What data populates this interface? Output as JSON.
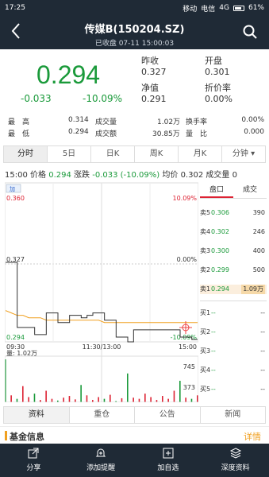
{
  "status": {
    "time": "17:25",
    "carrier1": "移动",
    "carrier2": "电信",
    "network": "4G",
    "battery": "61%"
  },
  "header": {
    "title": "传媒B(150204.SZ)",
    "subtitle": "已收盘 07-11 15:00:03"
  },
  "quote": {
    "price": "0.294",
    "change": "-0.033",
    "change_pct": "-10.09%",
    "prev_close_label": "昨收",
    "prev_close": "0.327",
    "open_label": "开盘",
    "open": "0.301",
    "nav_label": "净值",
    "nav": "0.291",
    "discount_label": "折价率",
    "discount": "0.00%"
  },
  "stats": {
    "high_label": "最　高",
    "high": "0.314",
    "volume_label": "成交量",
    "volume": "1.02万",
    "turnover_label": "换手率",
    "turnover": "0.00%",
    "low_label": "最　低",
    "low": "0.294",
    "amount_label": "成交额",
    "amount": "30.85万",
    "ratio_label": "量　比",
    "ratio": "0.000"
  },
  "tabs": [
    "分时",
    "5日",
    "日K",
    "周K",
    "月K",
    "分钟 ▾"
  ],
  "infoline": {
    "time": "15:00",
    "price_label": "价格",
    "price": "0.294",
    "chg_label": "涨跌",
    "chg": "-0.033 (-10.09%)",
    "avg_label": "均价",
    "avg": "0.302",
    "vol_label": "成交量",
    "vol": "0"
  },
  "chart": {
    "legend": "加",
    "top_price": "0.360",
    "top_pct": "10.09%",
    "mid_price": "0.327",
    "mid_pct": "0.00%",
    "bot_price": "0.294",
    "bot_pct": "-10.09%",
    "x_start": "09:30",
    "x_mid": "11:30/13:00",
    "x_end": "15:00",
    "vol_label": "量: 1.02万",
    "vol_high": "745",
    "vol_mid": "373"
  },
  "chart_data": {
    "type": "line",
    "ylim": [
      0.294,
      0.36
    ],
    "price": [
      0.327,
      0.327,
      0.3,
      0.3,
      0.3,
      0.297,
      0.297,
      0.306,
      0.306,
      0.302,
      0.302,
      0.305,
      0.305,
      0.304,
      0.305,
      0.306,
      0.306,
      0.303,
      0.303,
      0.296,
      0.296,
      0.294,
      0.299,
      0.299,
      0.299,
      0.299,
      0.299,
      0.299,
      0.299,
      0.299,
      0.296,
      0.296,
      0.295,
      0.295
    ],
    "avg": [
      0.307,
      0.306,
      0.305,
      0.305,
      0.304,
      0.304,
      0.304,
      0.303,
      0.303,
      0.303,
      0.303,
      0.303,
      0.303,
      0.303,
      0.303,
      0.303,
      0.303,
      0.302,
      0.302,
      0.302,
      0.302,
      0.302,
      0.302,
      0.302,
      0.302,
      0.302,
      0.302,
      0.302,
      0.302,
      0.302,
      0.302,
      0.302,
      0.302,
      0.302
    ],
    "volume": [
      745,
      120,
      60,
      280,
      90,
      150,
      40,
      200,
      60,
      30,
      80,
      110,
      50,
      300,
      120,
      40,
      90,
      60,
      130,
      20,
      70,
      500,
      80,
      60,
      150,
      90,
      40,
      110,
      60,
      200,
      373,
      80,
      60,
      120
    ]
  },
  "orderbook": {
    "tab1": "盘口",
    "tab2": "成交",
    "asks": [
      {
        "label": "卖5",
        "price": "0.306",
        "vol": "390"
      },
      {
        "label": "卖4",
        "price": "0.302",
        "vol": "246"
      },
      {
        "label": "卖3",
        "price": "0.300",
        "vol": "400"
      },
      {
        "label": "卖2",
        "price": "0.299",
        "vol": "500"
      },
      {
        "label": "卖1",
        "price": "0.294",
        "vol": "1.09万"
      }
    ],
    "bids": [
      {
        "label": "买1",
        "price": "--",
        "vol": "--"
      },
      {
        "label": "买2",
        "price": "--",
        "vol": "--"
      },
      {
        "label": "买3",
        "price": "--",
        "vol": "--"
      },
      {
        "label": "买4",
        "price": "--",
        "vol": "--"
      },
      {
        "label": "买5",
        "price": "--",
        "vol": "--"
      }
    ]
  },
  "bottom_tabs": [
    "资料",
    "重仓",
    "公告",
    "新闻"
  ],
  "fund": {
    "title": "基金信息",
    "more": "详情"
  },
  "nav": [
    {
      "label": "分享",
      "icon": "share-icon"
    },
    {
      "label": "添加提醒",
      "icon": "bell-icon"
    },
    {
      "label": "加自选",
      "icon": "add-icon"
    },
    {
      "label": "深度资料",
      "icon": "layers-icon"
    }
  ],
  "colors": {
    "up": "#d23",
    "down": "#1a9a3a",
    "header": "#1f2a36",
    "accent": "#f0a020"
  }
}
